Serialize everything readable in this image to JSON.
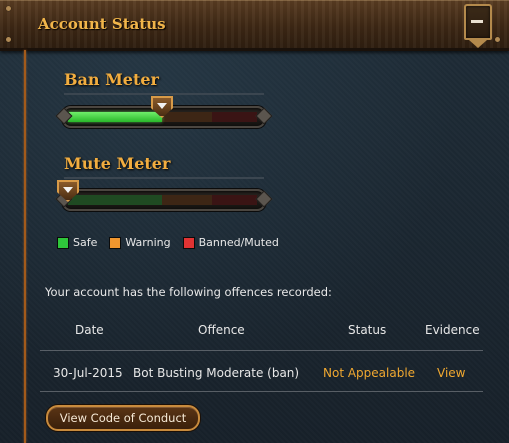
{
  "header": {
    "title": "Account Status"
  },
  "meters": {
    "ban": {
      "title": "Ban Meter",
      "level": 0.49
    },
    "mute": {
      "title": "Mute Meter",
      "level": 0.0
    }
  },
  "legend": {
    "safe": {
      "label": "Safe",
      "color": "#2fc63b"
    },
    "warning": {
      "label": "Warning",
      "color": "#f0962e"
    },
    "banned": {
      "label": "Banned/Muted",
      "color": "#e13333"
    }
  },
  "offences": {
    "intro": "Your account has the following offences recorded:",
    "columns": [
      "Date",
      "Offence",
      "Status",
      "Evidence"
    ],
    "rows": [
      {
        "date": "30-Jul-2015",
        "offence": "Bot Busting Moderate (ban)",
        "status": "Not Appealable",
        "evidence": "View"
      }
    ]
  },
  "buttons": {
    "code_of_conduct": "View Code of Conduct"
  },
  "icons": {
    "collapse": "minus-icon"
  }
}
